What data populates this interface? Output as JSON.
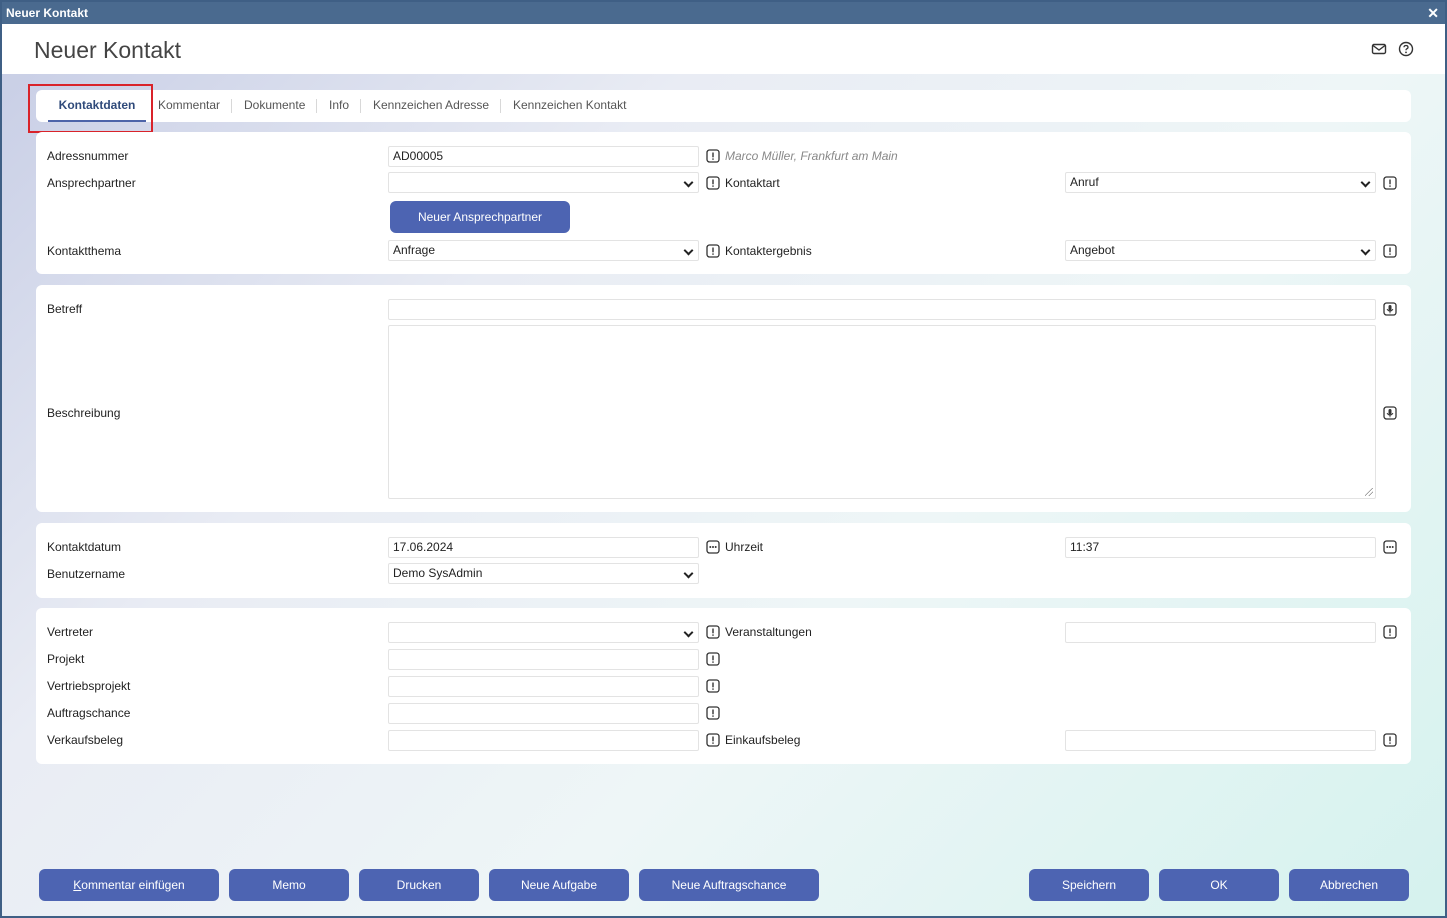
{
  "window": {
    "title": "Neuer Kontakt"
  },
  "header": {
    "title": "Neuer Kontakt"
  },
  "tabs": [
    {
      "label": "Kontaktdaten"
    },
    {
      "label": "Kommentar"
    },
    {
      "label": "Dokumente"
    },
    {
      "label": "Info"
    },
    {
      "label": "Kennzeichen Adresse"
    },
    {
      "label": "Kennzeichen Kontakt"
    }
  ],
  "contact": {
    "adressnummer_label": "Adressnummer",
    "adressnummer_value": "AD00005",
    "adress_hint": "Marco Müller, Frankfurt am Main",
    "ansprechpartner_label": "Ansprechpartner",
    "ansprechpartner_value": "",
    "kontaktart_label": "Kontaktart",
    "kontaktart_value": "Anruf",
    "new_contact_button": "Neuer Ansprechpartner",
    "kontaktthema_label": "Kontaktthema",
    "kontaktthema_value": "Anfrage",
    "kontaktergebnis_label": "Kontaktergebnis",
    "kontaktergebnis_value": "Angebot"
  },
  "subject": {
    "betreff_label": "Betreff",
    "betreff_value": "",
    "beschreibung_label": "Beschreibung",
    "beschreibung_value": ""
  },
  "date": {
    "kontaktdatum_label": "Kontaktdatum",
    "kontaktdatum_value": "17.06.2024",
    "uhrzeit_label": "Uhrzeit",
    "uhrzeit_value": "11:37",
    "benutzername_label": "Benutzername",
    "benutzername_value": "Demo SysAdmin"
  },
  "links": {
    "vertreter_label": "Vertreter",
    "veranstaltungen_label": "Veranstaltungen",
    "projekt_label": "Projekt",
    "vertriebsprojekt_label": "Vertriebsprojekt",
    "auftragschance_label": "Auftragschance",
    "verkaufsbeleg_label": "Verkaufsbeleg",
    "einkaufsbeleg_label": "Einkaufsbeleg"
  },
  "footer": {
    "kommentar": "Kommentar einfügen",
    "memo": "Memo",
    "drucken": "Drucken",
    "neue_aufgabe": "Neue Aufgabe",
    "neue_auftragschance": "Neue Auftragschance",
    "speichern": "Speichern",
    "ok": "OK",
    "abbrechen": "Abbrechen"
  },
  "colors": {
    "accent": "#4d64b2",
    "titlebar": "#4a6a8f",
    "highlight": "#d9232a"
  }
}
